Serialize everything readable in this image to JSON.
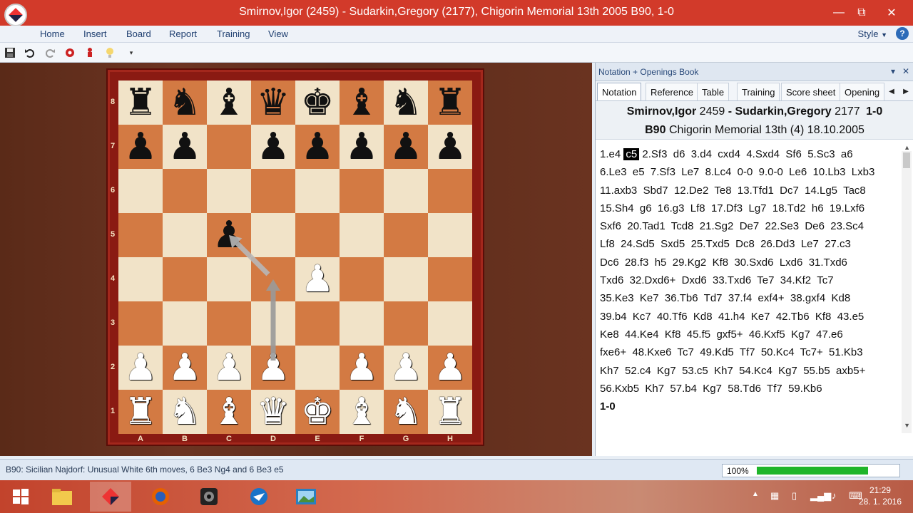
{
  "window": {
    "title": "Smirnov,Igor (2459) - Sudarkin,Gregory (2177), Chigorin Memorial 13th 2005  B90, 1-0",
    "minimize": "—",
    "maximize": "⧉",
    "close": "✕"
  },
  "ribbon": {
    "items": [
      "Home",
      "Insert",
      "Board",
      "Report",
      "Training",
      "View"
    ],
    "style_label": "Style",
    "style_caret": "▼",
    "help": "?"
  },
  "quick_toolbar": [
    "save-icon",
    "undo-icon",
    "redo-icon",
    "engine-icon",
    "piece-icon",
    "lightbulb-icon",
    "customize-icon"
  ],
  "board": {
    "ranks": [
      "8",
      "7",
      "6",
      "5",
      "4",
      "3",
      "2",
      "1"
    ],
    "files": [
      "A",
      "B",
      "C",
      "D",
      "E",
      "F",
      "G",
      "H"
    ],
    "position": [
      [
        "r",
        "n",
        "b",
        "q",
        "k",
        "b",
        "n",
        "r"
      ],
      [
        "p",
        "p",
        "",
        "p",
        "p",
        "p",
        "p",
        "p"
      ],
      [
        "",
        "",
        "",
        "",
        "",
        "",
        "",
        ""
      ],
      [
        "",
        "",
        "p",
        "",
        "",
        "",
        "",
        ""
      ],
      [
        "",
        "",
        "",
        "",
        "P",
        "",
        "",
        ""
      ],
      [
        "",
        "",
        "",
        "",
        "",
        "",
        "",
        ""
      ],
      [
        "P",
        "P",
        "P",
        "P",
        "",
        "P",
        "P",
        "P"
      ],
      [
        "R",
        "N",
        "B",
        "Q",
        "K",
        "B",
        "N",
        "R"
      ]
    ],
    "arrows": [
      {
        "from": "d2",
        "to": "d4",
        "color": "#9a9a9a"
      },
      {
        "from": "d4",
        "to": "c5",
        "color": "#b8b8b8"
      }
    ]
  },
  "notation_panel": {
    "title": "Notation + Openings Book",
    "tabs": [
      "Notation",
      "Reference",
      "Table",
      "Training",
      "Score sheet",
      "Opening"
    ],
    "active_tab": "Notation",
    "white_player": "Smirnov,Igor",
    "white_elo": "2459",
    "separator": "-",
    "black_player": "Sudarkin,Gregory",
    "black_elo": "2177",
    "result_header": "1-0",
    "eco": "B90",
    "event": "Chigorin Memorial 13th (4) 18.10.2005",
    "move_lines": [
      [
        "1.e4 ",
        "c5",
        " 2.Sf3  d6  3.d4  cxd4  4.Sxd4  Sf6  5.Sc3  a6"
      ],
      [
        "6.Le3  e5  7.Sf3  Le7  8.Lc4  0-0  9.0-0  Le6  10.Lb3  Lxb3"
      ],
      [
        "11.axb3  Sbd7  12.De2  Te8  13.Tfd1  Dc7  14.Lg5  Tac8"
      ],
      [
        "15.Sh4  g6  16.g3  Lf8  17.Df3  Lg7  18.Td2  h6  19.Lxf6"
      ],
      [
        "Sxf6  20.Tad1  Tcd8  21.Sg2  De7  22.Se3  De6  23.Sc4"
      ],
      [
        "Lf8  24.Sd5  Sxd5  25.Txd5  Dc8  26.Dd3  Le7  27.c3"
      ],
      [
        "Dc6  28.f3  h5  29.Kg2  Kf8  30.Sxd6  Lxd6  31.Txd6"
      ],
      [
        "Txd6  32.Dxd6+  Dxd6  33.Txd6  Te7  34.Kf2  Tc7"
      ],
      [
        "35.Ke3  Ke7  36.Tb6  Td7  37.f4  exf4+  38.gxf4  Kd8"
      ],
      [
        "39.b4  Kc7  40.Tf6  Kd8  41.h4  Ke7  42.Tb6  Kf8  43.e5"
      ],
      [
        "Ke8  44.Ke4  Kf8  45.f5  gxf5+  46.Kxf5  Kg7  47.e6"
      ],
      [
        "fxe6+  48.Kxe6  Tc7  49.Kd5  Tf7  50.Kc4  Tc7+  51.Kb3"
      ],
      [
        "Kh7  52.c4  Kg7  53.c5  Kh7  54.Kc4  Kg7  55.b5  axb5+"
      ],
      [
        "56.Kxb5  Kh7  57.b4  Kg7  58.Td6  Tf7  59.Kb6"
      ]
    ],
    "final_result": "1-0"
  },
  "status": {
    "text": "B90: Sicilian Najdorf: Unusual White 6th moves, 6 Be3 Ng4 and 6 Be3 e5",
    "zoom": "100%",
    "progress": 1.0,
    "progress_color": "#1fb52a"
  },
  "taskbar": {
    "apps": [
      "windows-start-icon",
      "file-explorer-icon",
      "chessbase-icon",
      "firefox-icon",
      "webcam-icon",
      "thunderbird-icon",
      "photo-viewer-icon"
    ],
    "active_app": "chessbase-icon",
    "time": "21:29",
    "date": "28. 1. 2016"
  },
  "colors": {
    "title_bar": "#d23a2a",
    "light_square": "#f1e3c8",
    "dark_square": "#d37a43",
    "frame": "#8a1a12"
  }
}
